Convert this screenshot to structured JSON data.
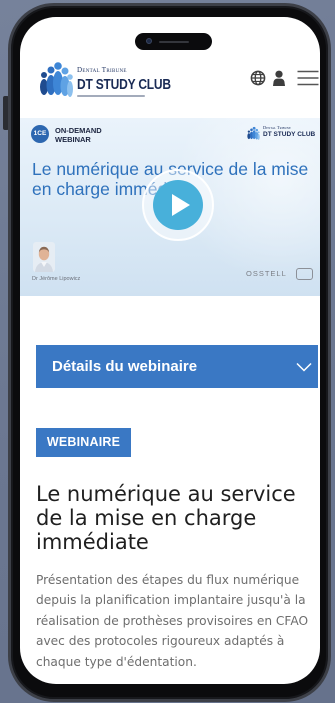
{
  "colors": {
    "background": "#6c7891",
    "accent_blue": "#3a78c4",
    "banner_title": "#2f72bc",
    "play_fill": "#48b0da",
    "heading": "#1f1f1f",
    "body_text": "#6e6e6e"
  },
  "header": {
    "logo_top": "Dental Tribune",
    "logo_name": "DT STUDY CLUB",
    "icons": {
      "language": "globe-icon",
      "account": "user-icon",
      "menu": "hamburger-menu-icon"
    }
  },
  "banner": {
    "credit_badge": "1CE",
    "kicker_line1": "ON-DEMAND",
    "kicker_line2": "WEBINAR",
    "logo_top": "Dental Tribune",
    "logo_name": "DT STUDY CLUB",
    "title": "Le numérique au service de la mise en charge immédiate",
    "speaker_name": "Dr Jérôme Lipowicz",
    "sponsor": "OSSTELL",
    "play_icon": "play-icon"
  },
  "details": {
    "label": "Détails du webinaire",
    "icon": "chevron-down-icon"
  },
  "content": {
    "tag": "WEBINAIRE",
    "title": "Le numérique au service de la mise en charge immédiate",
    "description": "Présentation des étapes du flux numérique depuis la planification implantaire jusqu'à la réalisation de prothèses provisoires en CFAO avec des protocoles rigoureux adaptés à chaque type d'édentation."
  }
}
